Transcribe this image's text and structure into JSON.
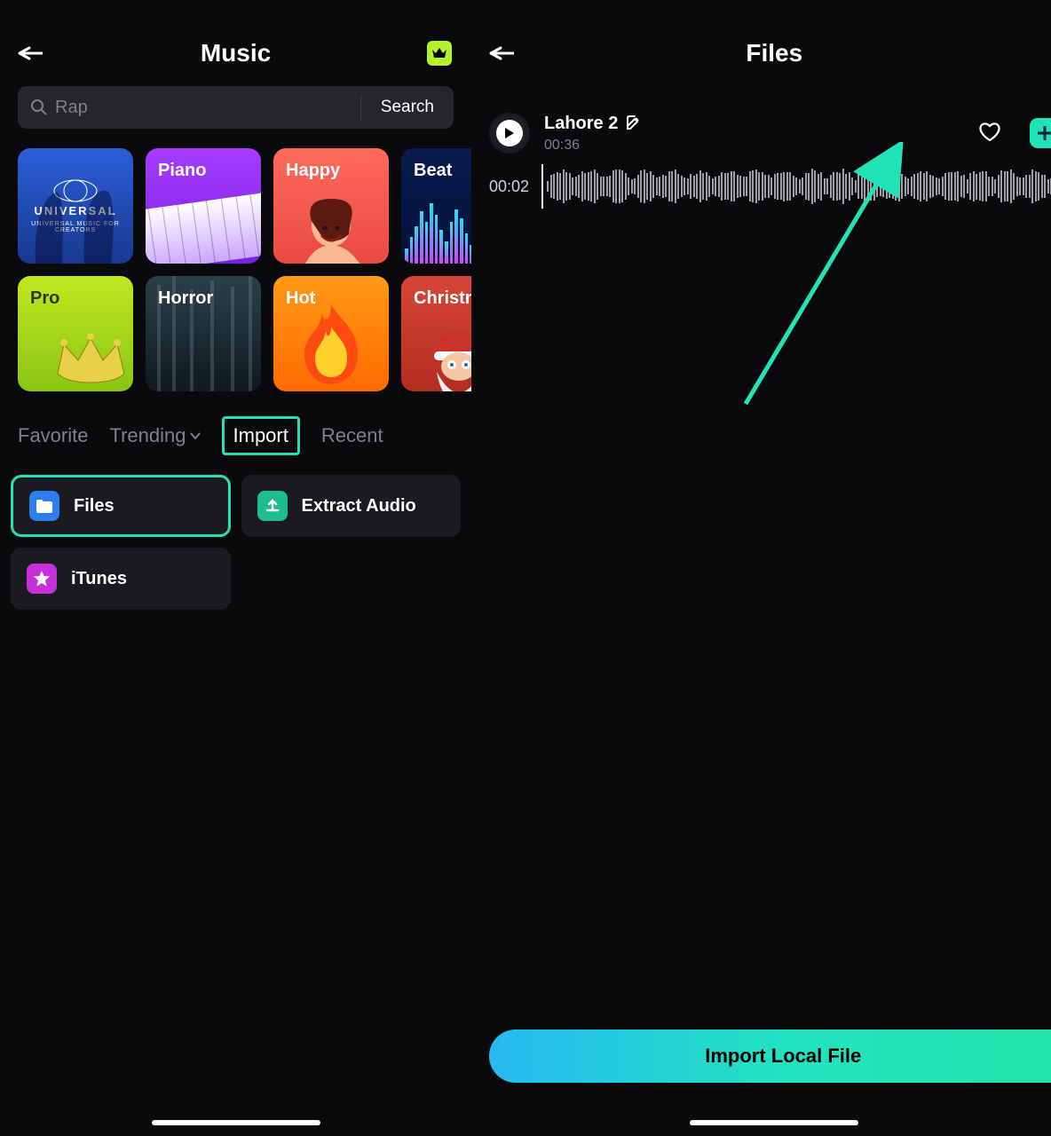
{
  "left": {
    "title": "Music",
    "search": {
      "placeholder": "Rap",
      "button": "Search"
    },
    "categories": [
      {
        "label": "",
        "brand_top": "UNIVERSAL",
        "brand_sub": "UNIVERSAL MUSIC FOR CREATORS"
      },
      {
        "label": "Piano"
      },
      {
        "label": "Happy"
      },
      {
        "label": "Beat"
      },
      {
        "label": "Pro"
      },
      {
        "label": "Horror"
      },
      {
        "label": "Hot"
      },
      {
        "label": "Christmas"
      }
    ],
    "tabs": {
      "favorite": "Favorite",
      "trending": "Trending",
      "import": "Import",
      "recent": "Recent"
    },
    "import_options": {
      "files": "Files",
      "extract": "Extract Audio",
      "itunes": "iTunes"
    }
  },
  "right": {
    "title": "Files",
    "track": {
      "name": "Lahore 2",
      "duration": "00:36",
      "position": "00:02"
    },
    "import_button": "Import Local File"
  },
  "colors": {
    "accent": "#21e3b7",
    "lime": "#b4f12a"
  }
}
